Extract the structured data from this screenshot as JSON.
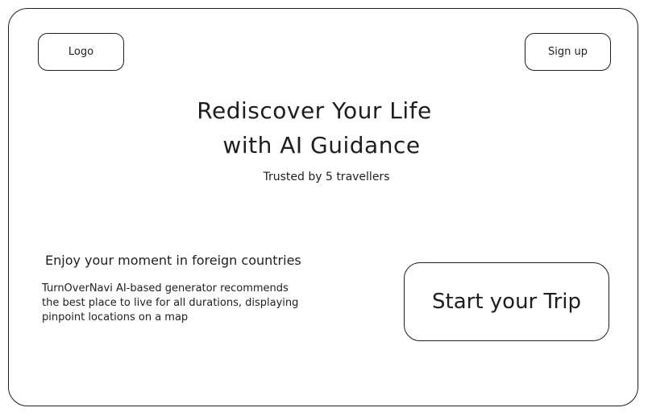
{
  "header": {
    "logo_label": "Logo",
    "signup_label": "Sign up"
  },
  "hero": {
    "title_line1": "Rediscover Your Life",
    "title_line2": "with AI Guidance",
    "subtitle": "Trusted by 5 travellers"
  },
  "section": {
    "title": "Enjoy your moment in foreign countries",
    "description_lines": [
      "TurnOverNavi AI-based generator recommends",
      "the best place to live for all durations, displaying",
      "pinpoint locations on a map"
    ]
  },
  "cta": {
    "label": "Start your Trip"
  }
}
